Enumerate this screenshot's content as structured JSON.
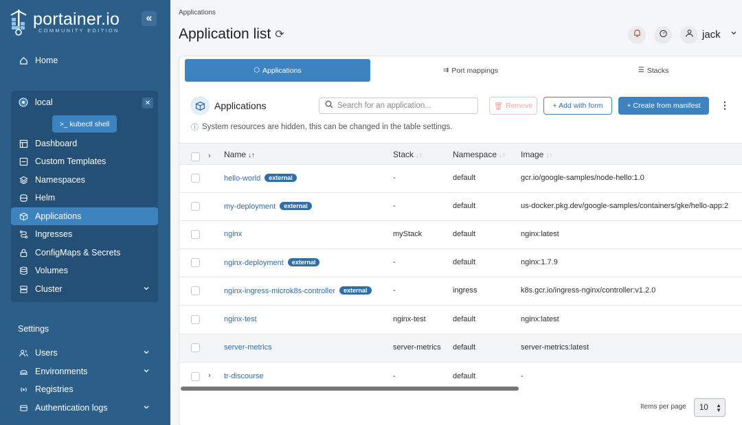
{
  "app": {
    "brand_name": "portainer.io",
    "brand_sub": "COMMUNITY EDITION"
  },
  "sidebar": {
    "home_label": "Home",
    "environment": {
      "name": "local",
      "kubectl_label": ">_ kubectl shell",
      "items": [
        {
          "label": "Dashboard",
          "icon": "dashboard-icon"
        },
        {
          "label": "Custom Templates",
          "icon": "templates-icon"
        },
        {
          "label": "Namespaces",
          "icon": "layers-icon"
        },
        {
          "label": "Helm",
          "icon": "helm-icon"
        },
        {
          "label": "Applications",
          "icon": "box-icon",
          "active": true
        },
        {
          "label": "Ingresses",
          "icon": "route-icon"
        },
        {
          "label": "ConfigMaps & Secrets",
          "icon": "lock-icon"
        },
        {
          "label": "Volumes",
          "icon": "database-icon"
        },
        {
          "label": "Cluster",
          "icon": "server-icon"
        }
      ]
    },
    "settings_title": "Settings",
    "settings_items": [
      {
        "label": "Users",
        "icon": "user-icon"
      },
      {
        "label": "Environments",
        "icon": "plug-icon"
      },
      {
        "label": "Registries",
        "icon": "radio-icon"
      },
      {
        "label": "Authentication logs",
        "icon": "log-icon"
      }
    ]
  },
  "header": {
    "breadcrumb": "Applications",
    "title": "Application list",
    "user": "jack"
  },
  "tabs": [
    {
      "label": "Applications",
      "active": true
    },
    {
      "label": "Port mappings",
      "active": false
    },
    {
      "label": "Stacks",
      "active": false
    }
  ],
  "panel": {
    "title": "Applications",
    "search_placeholder": "Search for an application...",
    "remove_label": "Remove",
    "add_form_label": "+ Add with form",
    "create_manifest_label": "+ Create from manifest",
    "info": "System resources are hidden, this can be changed in the table settings."
  },
  "table": {
    "columns": [
      "Name",
      "Stack",
      "Namespace",
      "Image"
    ],
    "rows": [
      {
        "name": "hello-world",
        "external": true,
        "stack": "-",
        "namespace": "default",
        "image": "gcr.io/google-samples/node-hello:1.0"
      },
      {
        "name": "my-deployment",
        "external": true,
        "stack": "-",
        "namespace": "default",
        "image": "us-docker.pkg.dev/google-samples/containers/gke/hello-app:2"
      },
      {
        "name": "nginx",
        "external": false,
        "stack": "myStack",
        "namespace": "default",
        "image": "nginx:latest"
      },
      {
        "name": "nginx-deployment",
        "external": true,
        "stack": "-",
        "namespace": "default",
        "image": "nginx:1.7.9"
      },
      {
        "name": "nginx-ingress-microk8s-controller",
        "external": true,
        "stack": "-",
        "namespace": "ingress",
        "image": "k8s.gcr.io/ingress-nginx/controller:v1.2.0"
      },
      {
        "name": "nginx-test",
        "external": false,
        "stack": "nginx-test",
        "namespace": "default",
        "image": "nginx:latest"
      },
      {
        "name": "server-metrics",
        "external": false,
        "stack": "server-metrics",
        "namespace": "default",
        "image": "server-metrics:latest"
      },
      {
        "name": "tr-discourse",
        "external": false,
        "expandable": true,
        "stack": "-",
        "namespace": "default",
        "image": "-"
      }
    ],
    "badge_label": "external",
    "items_per_page_label": "Items per page",
    "items_per_page": "10"
  },
  "colors": {
    "sidebar": "#2c5e8a",
    "accent": "#3d83c0",
    "link": "#2d6da8"
  }
}
